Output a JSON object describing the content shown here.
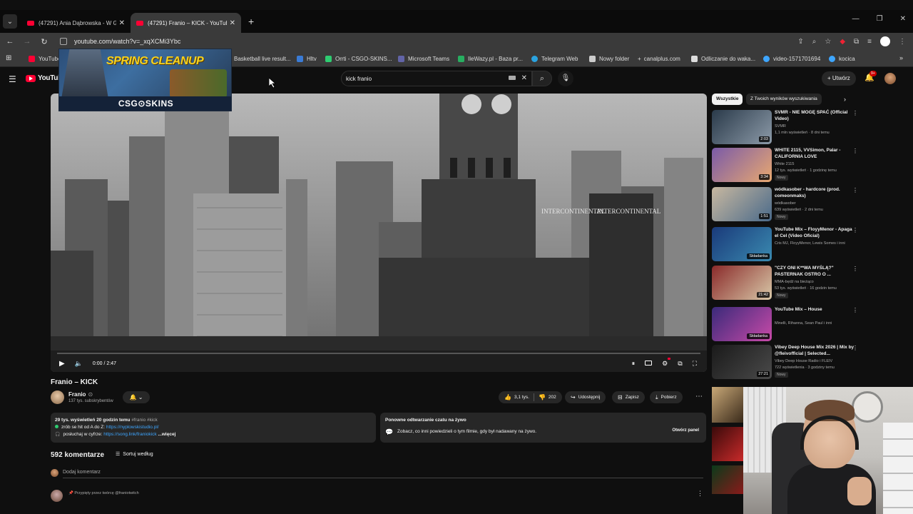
{
  "browser": {
    "tabs": [
      {
        "title": "(47291) Ania Dąbrowska - W Gł",
        "active": false
      },
      {
        "title": "(47291) Franio – KICK - YouTube",
        "active": true
      }
    ],
    "url": "youtube.com/watch?v=_xqXCMi3Ybc",
    "bookmarks": [
      {
        "label": "YouTube",
        "color": "#ff0033"
      },
      {
        "label": "Basketball live result...",
        "color": "#888888"
      },
      {
        "label": "Hltv",
        "color": "#3a7bd5"
      },
      {
        "label": "Orrti - CSGO-SKINS...",
        "color": "#2ecc71"
      },
      {
        "label": "Microsoft Teams",
        "color": "#6264a7"
      },
      {
        "label": "IleWazy.pl - Baza pr...",
        "color": "#27ae60"
      },
      {
        "label": "Telegram Web",
        "color": "#2aa3e0"
      },
      {
        "label": "Nowy folder",
        "color": "#cccccc"
      },
      {
        "label": "canalplus.com",
        "color": "#eeeeee"
      },
      {
        "label": "Odliczanie do waka...",
        "color": "#dddddd"
      },
      {
        "label": "video-1571701694",
        "color": "#3ea6ff"
      },
      {
        "label": "kocica",
        "color": "#3ea6ff"
      }
    ]
  },
  "yt": {
    "logo": "YouTube",
    "search_value": "kick franio",
    "create_label": "Utwórz",
    "notif_count": "9+"
  },
  "overlay": {
    "headline": "SPRING CLEANUP",
    "brand": "CSG⊙SKINS"
  },
  "player": {
    "time": "0:00 / 2:47",
    "progress": 0,
    "signs": [
      "INTERCONTINENTAL",
      "INTERCONTINENTAL"
    ]
  },
  "video": {
    "title": "Franio – KICK",
    "channel": "Franio",
    "subscribers": "137 tys. subskrybentów",
    "likes": "3,1 tys.",
    "dislikes": "202",
    "share": "Udostępnij",
    "save": "Zapisz",
    "download": "Pobierz"
  },
  "description": {
    "views": "29 tys. wyświetleń",
    "date": "20 godzin temu",
    "tags": "#franio #kick",
    "line1_prefix": "zrób se hit od A do Z: ",
    "line1_link": "https://nyplowskistudio.pl/",
    "line2_prefix": "posłuchaj w cyfrze: ",
    "line2_link": "https://song.link/franiokick",
    "more": "...więcej"
  },
  "chat_replay": {
    "heading": "Ponowne odtwarzanie czatu na żywo",
    "text": "Zobacz, co inni powiedzieli o tym filmie, gdy był nadawany na żywo.",
    "button": "Otwórz panel"
  },
  "comments": {
    "count": "592 komentarze",
    "sort": "Sortuj według",
    "add_placeholder": "Dodaj komentarz",
    "pinned_note": "Przypięty przez twórcę @franiotwitch"
  },
  "filters": {
    "chips": [
      "Wszystkie",
      "Z Twoich wyników wyszukiwania"
    ]
  },
  "recommendations": [
    {
      "title": "SVMR - NIE MOGĘ SPAĆ (Official Video)",
      "channel": "SVMR",
      "meta": "1,1 mln wyświetleń · 8 dni temu",
      "badge": "",
      "duration": "2:03",
      "colors": [
        "#2a3a4a",
        "#8c9aa8"
      ]
    },
    {
      "title": "WHITE 2115, VVSimon, Palar - CALIFORNIA LOVE",
      "channel": "White 2115",
      "meta": "12 tys. wyświetleń · 1 godzinę temu",
      "badge": "Nowy",
      "duration": "3:34",
      "colors": [
        "#7a5aa8",
        "#e8a870"
      ]
    },
    {
      "title": "wódkasober - hardcore (prod. comeonmaks)",
      "channel": "wódkasober",
      "meta": "639 wyświetleń · 2 dni temu",
      "badge": "Nowy",
      "duration": "1:51",
      "colors": [
        "#c8b8a0",
        "#4a6a8a"
      ]
    },
    {
      "title": "YouTube Mix – FloyyMenor - Apaga el Cel (Video Oficial)",
      "channel": "Cris MJ, FloyyMenor, Lewis Somes i inni",
      "meta": "",
      "badge": "",
      "duration": "Składanka",
      "colors": [
        "#1a3a7a",
        "#3a8ab0"
      ]
    },
    {
      "title": "\"CZY ONI K**WA MYŚLĄ?\" PASTERNAK OSTRO O ...",
      "channel": "MMA-będź na bieżąco",
      "meta": "53 tys. wyświetleń · 16 godzin temu",
      "badge": "Nowy",
      "duration": "21:42",
      "colors": [
        "#8a2a2a",
        "#d8c8a8"
      ]
    },
    {
      "title": "YouTube Mix – House",
      "channel": "Minelli, Rihanna, Sean Paul i inni",
      "meta": "",
      "badge": "",
      "duration": "Składanka",
      "colors": [
        "#3a2a7a",
        "#c84aa8"
      ]
    },
    {
      "title": "Vibey Deep House Mix 2026 | Mix by @fleivofficial | Selected...",
      "channel": "Vibey Deep House Radio i FLEIV",
      "meta": "722 wyświetlenia · 3 godziny temu",
      "badge": "Nowy",
      "duration": "27:21",
      "colors": [
        "#1a1a1a",
        "#4a4a4a"
      ]
    }
  ]
}
